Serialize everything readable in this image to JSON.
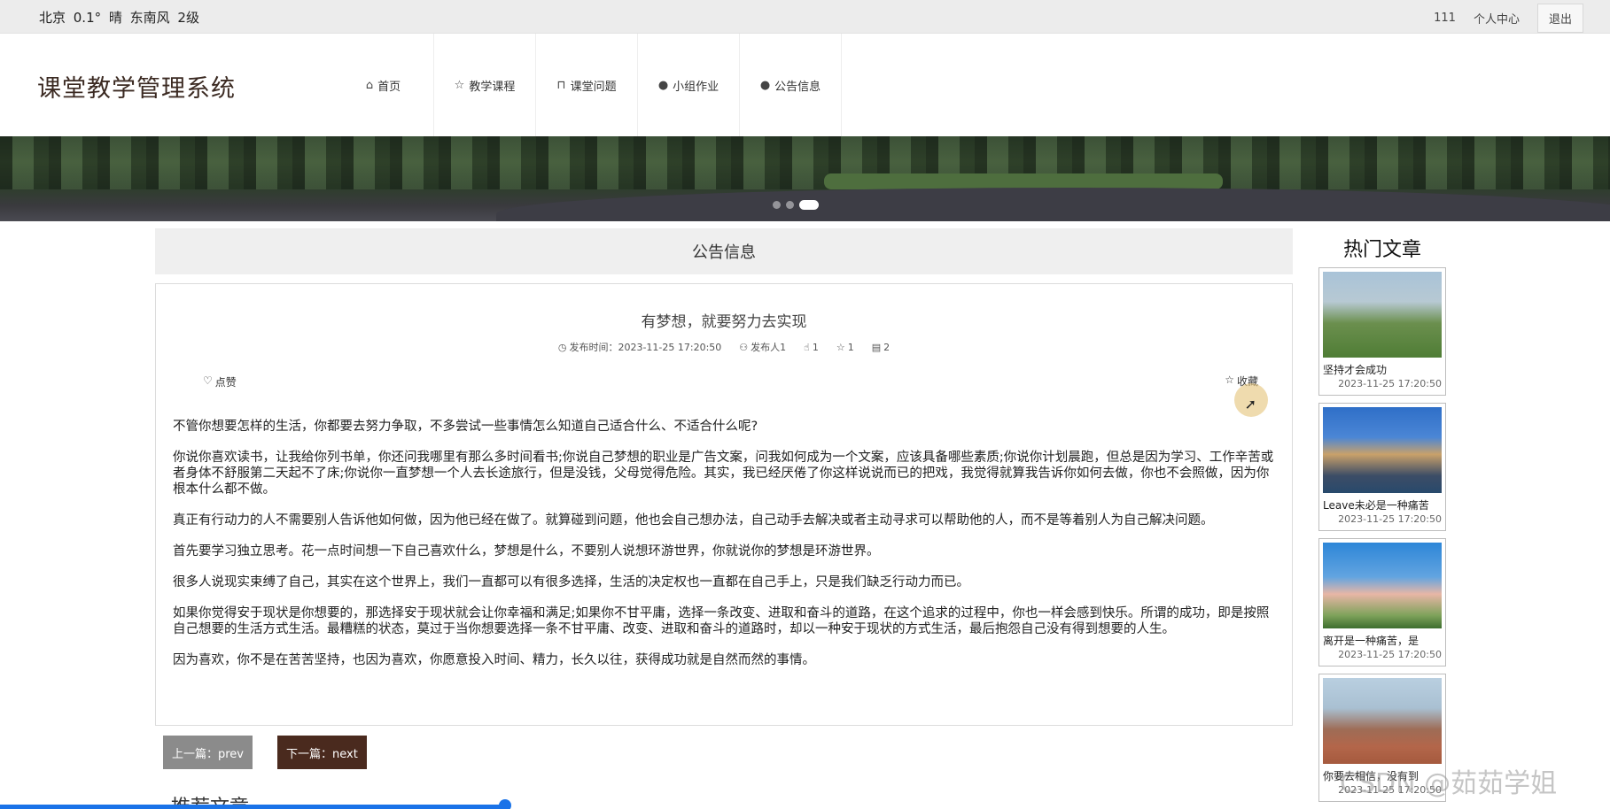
{
  "topbar": {
    "weather": "北京  0.1°  晴  东南风  2级",
    "user": "111",
    "profile": "个人中心",
    "logout": "退出"
  },
  "header": {
    "logo": "课堂教学管理系统",
    "nav": [
      {
        "icon": "home-icon",
        "label": "首页"
      },
      {
        "icon": "star-icon",
        "label": "教学课程"
      },
      {
        "icon": "lock-icon",
        "label": "课堂问题"
      },
      {
        "icon": "alert-icon",
        "label": "小组作业"
      },
      {
        "icon": "help-icon",
        "label": "公告信息"
      }
    ]
  },
  "banner": {
    "slides": 3,
    "active_slide": 3
  },
  "section": {
    "title": "公告信息"
  },
  "article": {
    "title": "有梦想，就要努力去实现",
    "meta": {
      "publish_time": "发布时间：2023-11-25 17:20:50",
      "publisher": "发布人1",
      "likes": "1",
      "favorites": "1",
      "views": "2"
    },
    "like_label": "点赞",
    "collect_label": "收藏",
    "paragraphs": [
      "不管你想要怎样的生活，你都要去努力争取，不多尝试一些事情怎么知道自己适合什么、不适合什么呢?",
      "你说你喜欢读书，让我给你列书单，你还问我哪里有那么多时间看书;你说自己梦想的职业是广告文案，问我如何成为一个文案，应该具备哪些素质;你说你计划晨跑，但总是因为学习、工作辛苦或者身体不舒服第二天起不了床;你说你一直梦想一个人去长途旅行，但是没钱，父母觉得危险。其实，我已经厌倦了你这样说说而已的把戏，我觉得就算我告诉你如何去做，你也不会照做，因为你根本什么都不做。",
      "真正有行动力的人不需要别人告诉他如何做，因为他已经在做了。就算碰到问题，他也会自己想办法，自己动手去解决或者主动寻求可以帮助他的人，而不是等着别人为自己解决问题。",
      "首先要学习独立思考。花一点时间想一下自己喜欢什么，梦想是什么，不要别人说想环游世界，你就说你的梦想是环游世界。",
      "很多人说现实束缚了自己，其实在这个世界上，我们一直都可以有很多选择，生活的决定权也一直都在自己手上，只是我们缺乏行动力而已。",
      "如果你觉得安于现状是你想要的，那选择安于现状就会让你幸福和满足;如果你不甘平庸，选择一条改变、进取和奋斗的道路，在这个追求的过程中，你也一样会感到快乐。所谓的成功，即是按照自己想要的生活方式生活。最糟糕的状态，莫过于当你想要选择一条不甘平庸、改变、进取和奋斗的道路时，却以一种安于现状的方式生活，最后抱怨自己没有得到想要的人生。",
      "因为喜欢，你不是在苦苦坚持，也因为喜欢，你愿意投入时间、精力，长久以往，获得成功就是自然而然的事情。"
    ]
  },
  "pager": {
    "prev": "上一篇：prev",
    "next": "下一篇：next"
  },
  "recommend": {
    "title": "推荐文章"
  },
  "hot": {
    "title": "热门文章",
    "items": [
      {
        "name": "坚持才会成功",
        "date": "2023-11-25 17:20:50"
      },
      {
        "name": "Leave未必是一种痛苦",
        "date": "2023-11-25 17:20:50"
      },
      {
        "name": "离开是一种痛苦，是",
        "date": "2023-11-25 17:20:50"
      },
      {
        "name": "你要去相信，没有到",
        "date": "2023-11-25 17:20:50"
      }
    ]
  },
  "watermark": "CSDN @茹茹学姐",
  "colors": {
    "accent_dark": "#4a2a1e",
    "prev_button": "#8b8b8b",
    "progress": "#1a73e8"
  }
}
